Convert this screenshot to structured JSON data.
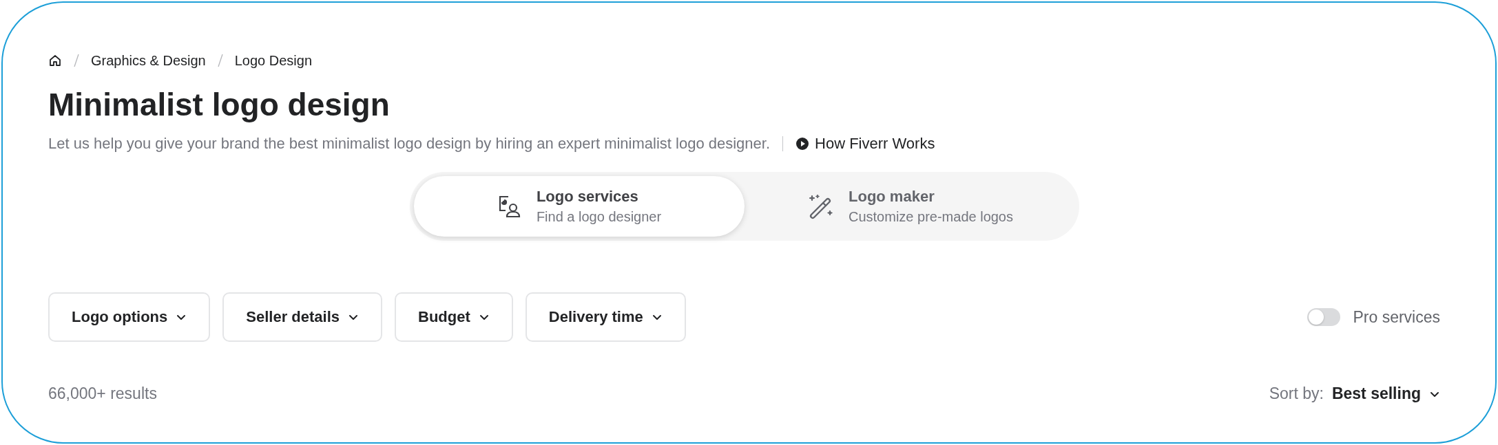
{
  "breadcrumbs": [
    {
      "label": "Graphics & Design"
    },
    {
      "label": "Logo Design"
    }
  ],
  "title": "Minimalist logo design",
  "description": "Let us help you give your brand the best minimalist logo design by hiring an expert minimalist logo designer.",
  "how_it_works": "How Fiverr Works",
  "segments": [
    {
      "kind": "services",
      "title": "Logo services",
      "subtitle": "Find a logo designer",
      "selected": true
    },
    {
      "kind": "maker",
      "title": "Logo maker",
      "subtitle": "Customize pre-made logos",
      "selected": false
    }
  ],
  "filters": [
    {
      "label": "Logo options"
    },
    {
      "label": "Seller details"
    },
    {
      "label": "Budget"
    },
    {
      "label": "Delivery time"
    }
  ],
  "pro_services": {
    "label": "Pro services",
    "on": false
  },
  "results_count": "66,000+ results",
  "sort": {
    "label": "Sort by:",
    "value": "Best selling"
  }
}
